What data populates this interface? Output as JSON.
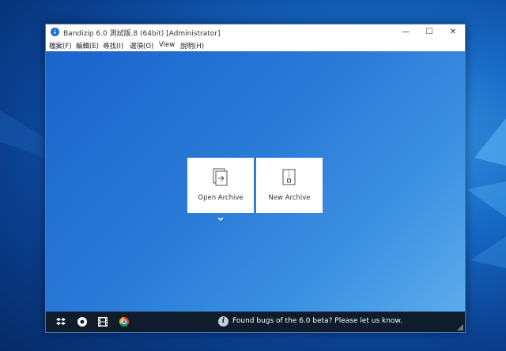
{
  "window": {
    "title": "Bandizip 6.0 測試版.8 (64bit) [Administrator]",
    "minimize_glyph": "—",
    "maximize_glyph": "☐",
    "close_glyph": "✕"
  },
  "menu": {
    "items": [
      {
        "label": "檔案(F)"
      },
      {
        "label": "編輯(E)"
      },
      {
        "label": "尋找(I)"
      },
      {
        "label": "選項(O)"
      },
      {
        "label": "View"
      },
      {
        "label": "說明(H)"
      }
    ]
  },
  "main": {
    "open_archive_label": "Open Archive",
    "new_archive_label": "New Archive"
  },
  "status": {
    "bug_message": "Found bugs of the 6.0 beta? Please let us know.",
    "info_glyph": "i"
  },
  "colors": {
    "accent": "#1f6fd1",
    "bottombar": "#0e1c2c",
    "content_blue": "#2a7ad8"
  }
}
